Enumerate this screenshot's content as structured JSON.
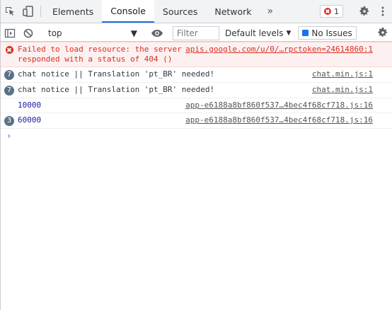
{
  "tabs": [
    {
      "label": "Elements"
    },
    {
      "label": "Console"
    },
    {
      "label": "Sources"
    },
    {
      "label": "Network"
    }
  ],
  "more_tabs": "»",
  "error_count": "1",
  "toolbar": {
    "context": "top",
    "filter_placeholder": "Filter",
    "levels": "Default levels",
    "issues": "No Issues"
  },
  "messages": [
    {
      "type": "error",
      "text": "Failed to load resource: the server\nresponded with a status of 404 ()",
      "source": "apis.google.com/u/0/…rpctoken=24614860:1"
    },
    {
      "type": "log",
      "count": "7",
      "text": "chat notice || Translation 'pt_BR' needed!",
      "source": "chat.min.js:1"
    },
    {
      "type": "log",
      "count": "7",
      "text": "chat notice || Translation 'pt_BR' needed!",
      "source": "chat.min.js:1"
    },
    {
      "type": "log",
      "count": "",
      "text": "10000",
      "source": "app-e6188a8bf860f537…4bec4f68cf718.js:16"
    },
    {
      "type": "log",
      "count": "3",
      "text": "60000",
      "source": "app-e6188a8bf860f537…4bec4f68cf718.js:16"
    }
  ],
  "prompt_symbol": "›",
  "colors": {
    "accent": "#1a73e8",
    "error": "#d93025",
    "number": "#1a1aa6"
  }
}
